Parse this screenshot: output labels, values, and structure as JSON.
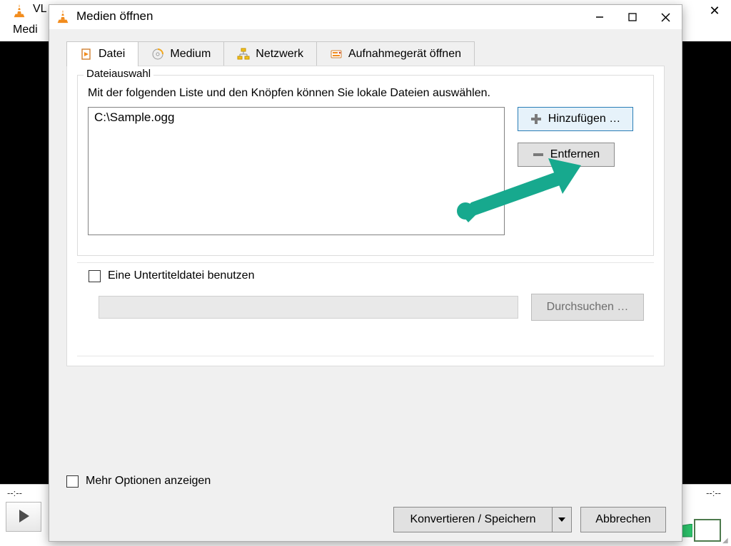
{
  "background": {
    "title_fragment": "VL",
    "menu_fragment": "Medi",
    "time_left": "--:--",
    "time_right": "--:--"
  },
  "dialog": {
    "title": "Medien öffnen",
    "tabs": {
      "file": "Datei",
      "disc": "Medium",
      "network": "Netzwerk",
      "capture": "Aufnahmegerät öffnen"
    },
    "file_selection": {
      "legend": "Dateiauswahl",
      "instruction": "Mit der folgenden Liste und den Knöpfen können Sie lokale Dateien auswählen.",
      "files": [
        "C:\\Sample.ogg"
      ],
      "add_label": "Hinzufügen …",
      "remove_label": "Entfernen"
    },
    "subtitles": {
      "checkbox_label": "Eine Untertiteldatei benutzen",
      "browse_label": "Durchsuchen …"
    },
    "more_options_label": "Mehr Optionen anzeigen",
    "convert_label": "Konvertieren / Speichern",
    "cancel_label": "Abbrechen"
  },
  "annotation": {
    "arrow_color": "#17a98e"
  }
}
